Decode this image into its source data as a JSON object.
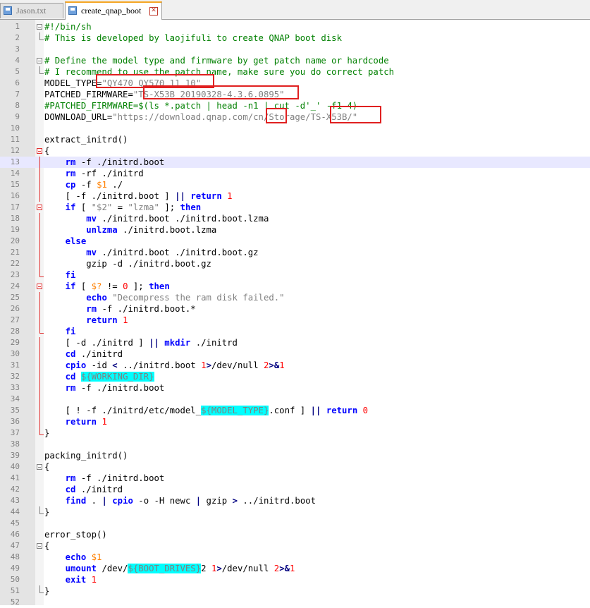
{
  "tabs": [
    {
      "label": "Jason.txt",
      "active": false,
      "icon": "save-icon"
    },
    {
      "label": "create_qnap_boot",
      "active": true,
      "icon": "save-icon",
      "close_icon": "close-icon"
    }
  ],
  "lines": [
    {
      "n": "1",
      "seg": [
        [
          "c-comment",
          "#!/bin/sh"
        ]
      ],
      "fold": "boxg"
    },
    {
      "n": "2",
      "seg": [
        [
          "c-comment",
          "# This is developed by laojifuli to create QNAP boot disk"
        ]
      ],
      "fold": "endg"
    },
    {
      "n": "3",
      "seg": [],
      "fold": ""
    },
    {
      "n": "4",
      "seg": [
        [
          "c-comment",
          "# Define the model type and firmware by get patch name or hardcode"
        ]
      ],
      "fold": "boxg"
    },
    {
      "n": "5",
      "seg": [
        [
          "c-comment",
          "# I recommend to use the patch name, make sure you do correct patch"
        ]
      ],
      "fold": "endg"
    },
    {
      "n": "6",
      "seg": [
        [
          "",
          "MODEL_TYPE="
        ],
        [
          "c-str",
          "\"QY470_QY570_11_10\""
        ]
      ],
      "fold": ""
    },
    {
      "n": "7",
      "seg": [
        [
          "",
          "PATCHED_FIRMWARE="
        ],
        [
          "c-str",
          "\"TS-X53B_20190328-4.3.6.0895\""
        ]
      ],
      "fold": ""
    },
    {
      "n": "8",
      "seg": [
        [
          "c-comment",
          "#PATCHED_FIRMWARE=$(ls *.patch | head -n1 | cut -d'_' -f1-4)"
        ]
      ],
      "fold": ""
    },
    {
      "n": "9",
      "seg": [
        [
          "",
          "DOWNLOAD_URL="
        ],
        [
          "c-str",
          "\"https://download.qnap.com/cn/Storage/TS-X53B/\""
        ]
      ],
      "fold": ""
    },
    {
      "n": "10",
      "seg": [],
      "fold": ""
    },
    {
      "n": "11",
      "seg": [
        [
          "",
          "extract_initrd()"
        ]
      ],
      "fold": ""
    },
    {
      "n": "12",
      "seg": [
        [
          "",
          "{"
        ]
      ],
      "fold": "box"
    },
    {
      "n": "13",
      "seg": [
        [
          "",
          "    "
        ],
        [
          "c-kw",
          "rm"
        ],
        [
          "",
          "",
          " -f ./initrd.boot"
        ]
      ],
      "fold": "bar",
      "current": true
    },
    {
      "n": "14",
      "seg": [
        [
          "",
          "    "
        ],
        [
          "c-kw",
          "rm"
        ],
        [
          "",
          " -rf ./initrd"
        ]
      ],
      "fold": "bar"
    },
    {
      "n": "15",
      "seg": [
        [
          "",
          "    "
        ],
        [
          "c-kw",
          "cp"
        ],
        [
          "",
          " -f "
        ],
        [
          "c-var",
          "$1"
        ],
        [
          "",
          " ./"
        ]
      ],
      "fold": "bar"
    },
    {
      "n": "16",
      "seg": [
        [
          "",
          "    [ -f ./initrd.boot ] "
        ],
        [
          "c-op",
          "||"
        ],
        [
          "",
          " "
        ],
        [
          "c-kw",
          "return"
        ],
        [
          "",
          " "
        ],
        [
          "c-num",
          "1"
        ]
      ],
      "fold": "bar"
    },
    {
      "n": "17",
      "seg": [
        [
          "",
          "    "
        ],
        [
          "c-kw",
          "if"
        ],
        [
          "",
          " [ "
        ],
        [
          "c-str",
          "\"$2\""
        ],
        [
          "",
          " = "
        ],
        [
          "c-str",
          "\"lzma\""
        ],
        [
          "",
          " ]; "
        ],
        [
          "c-kw",
          "then"
        ]
      ],
      "fold": "box"
    },
    {
      "n": "18",
      "seg": [
        [
          "",
          "        "
        ],
        [
          "c-kw",
          "mv"
        ],
        [
          "",
          " ./initrd.boot ./initrd.boot.lzma"
        ]
      ],
      "fold": "bar"
    },
    {
      "n": "19",
      "seg": [
        [
          "",
          "        "
        ],
        [
          "c-kw",
          "unlzma"
        ],
        [
          "",
          " ./initrd.boot.lzma"
        ]
      ],
      "fold": "bar"
    },
    {
      "n": "20",
      "seg": [
        [
          "",
          "    "
        ],
        [
          "c-kw",
          "else"
        ]
      ],
      "fold": "bar"
    },
    {
      "n": "21",
      "seg": [
        [
          "",
          "        "
        ],
        [
          "c-kw",
          "mv"
        ],
        [
          "",
          " ./initrd.boot ./initrd.boot.gz"
        ]
      ],
      "fold": "bar"
    },
    {
      "n": "22",
      "seg": [
        [
          "",
          "        gzip -d ./initrd.boot.gz"
        ]
      ],
      "fold": "bar"
    },
    {
      "n": "23",
      "seg": [
        [
          "",
          "    "
        ],
        [
          "c-kw",
          "fi"
        ]
      ],
      "fold": "end"
    },
    {
      "n": "24",
      "seg": [
        [
          "",
          "    "
        ],
        [
          "c-kw",
          "if"
        ],
        [
          "",
          " [ "
        ],
        [
          "c-var",
          "$?"
        ],
        [
          "",
          " != "
        ],
        [
          "c-num",
          "0"
        ],
        [
          "",
          " ]; "
        ],
        [
          "c-kw",
          "then"
        ]
      ],
      "fold": "box"
    },
    {
      "n": "25",
      "seg": [
        [
          "",
          "        "
        ],
        [
          "c-kw",
          "echo"
        ],
        [
          "",
          " "
        ],
        [
          "c-str",
          "\"Decompress the ram disk failed.\""
        ]
      ],
      "fold": "bar"
    },
    {
      "n": "26",
      "seg": [
        [
          "",
          "        "
        ],
        [
          "c-kw",
          "rm"
        ],
        [
          "",
          " -f ./initrd.boot.*"
        ]
      ],
      "fold": "bar"
    },
    {
      "n": "27",
      "seg": [
        [
          "",
          "        "
        ],
        [
          "c-kw",
          "return"
        ],
        [
          "",
          " "
        ],
        [
          "c-num",
          "1"
        ]
      ],
      "fold": "bar"
    },
    {
      "n": "28",
      "seg": [
        [
          "",
          "    "
        ],
        [
          "c-kw",
          "fi"
        ]
      ],
      "fold": "end"
    },
    {
      "n": "29",
      "seg": [
        [
          "",
          "    [ -d ./initrd ] "
        ],
        [
          "c-op",
          "||"
        ],
        [
          "",
          " "
        ],
        [
          "c-kw",
          "mkdir"
        ],
        [
          "",
          " ./initrd"
        ]
      ],
      "fold": "bar"
    },
    {
      "n": "30",
      "seg": [
        [
          "",
          "    "
        ],
        [
          "c-kw",
          "cd"
        ],
        [
          "",
          " ./initrd"
        ]
      ],
      "fold": "bar"
    },
    {
      "n": "31",
      "seg": [
        [
          "",
          "    "
        ],
        [
          "c-kw",
          "cpio"
        ],
        [
          "",
          " -id "
        ],
        [
          "c-op",
          "<"
        ],
        [
          "",
          " ../initrd.boot "
        ],
        [
          "c-num",
          "1"
        ],
        [
          "c-op",
          ">"
        ],
        [
          "",
          "/dev/null "
        ],
        [
          "c-num",
          "2"
        ],
        [
          "c-op",
          ">&"
        ],
        [
          "c-num",
          "1"
        ]
      ],
      "fold": "bar"
    },
    {
      "n": "32",
      "seg": [
        [
          "",
          "    "
        ],
        [
          "c-kw",
          "cd"
        ],
        [
          "",
          " "
        ],
        [
          "c-hl",
          "${WORKING_DIR}"
        ]
      ],
      "fold": "bar"
    },
    {
      "n": "33",
      "seg": [
        [
          "",
          "    "
        ],
        [
          "c-kw",
          "rm"
        ],
        [
          "",
          " -f ./initrd.boot"
        ]
      ],
      "fold": "bar"
    },
    {
      "n": "34",
      "seg": [],
      "fold": "bar"
    },
    {
      "n": "35",
      "seg": [
        [
          "",
          "    [ ! -f ./initrd/etc/model_"
        ],
        [
          "c-hl",
          "${MODEL_TYPE}"
        ],
        [
          "",
          ".conf ] "
        ],
        [
          "c-op",
          "||"
        ],
        [
          "",
          " "
        ],
        [
          "c-kw",
          "return"
        ],
        [
          "",
          " "
        ],
        [
          "c-num",
          "0"
        ]
      ],
      "fold": "bar"
    },
    {
      "n": "36",
      "seg": [
        [
          "",
          "    "
        ],
        [
          "c-kw",
          "return"
        ],
        [
          "",
          " "
        ],
        [
          "c-num",
          "1"
        ]
      ],
      "fold": "bar"
    },
    {
      "n": "37",
      "seg": [
        [
          "",
          "}"
        ]
      ],
      "fold": "end"
    },
    {
      "n": "38",
      "seg": [],
      "fold": ""
    },
    {
      "n": "39",
      "seg": [
        [
          "",
          "packing_initrd()"
        ]
      ],
      "fold": ""
    },
    {
      "n": "40",
      "seg": [
        [
          "",
          "{"
        ]
      ],
      "fold": "boxg"
    },
    {
      "n": "41",
      "seg": [
        [
          "",
          "    "
        ],
        [
          "c-kw",
          "rm"
        ],
        [
          "",
          " -f ./initrd.boot"
        ]
      ],
      "fold": ""
    },
    {
      "n": "42",
      "seg": [
        [
          "",
          "    "
        ],
        [
          "c-kw",
          "cd"
        ],
        [
          "",
          " ./initrd"
        ]
      ],
      "fold": ""
    },
    {
      "n": "43",
      "seg": [
        [
          "",
          "    "
        ],
        [
          "c-kw",
          "find"
        ],
        [
          "",
          " . "
        ],
        [
          "c-op",
          "|"
        ],
        [
          "",
          " "
        ],
        [
          "c-kw",
          "cpio"
        ],
        [
          "",
          " -o -H newc "
        ],
        [
          "c-op",
          "|"
        ],
        [
          "",
          " gzip "
        ],
        [
          "c-op",
          ">"
        ],
        [
          "",
          " ../initrd.boot"
        ]
      ],
      "fold": ""
    },
    {
      "n": "44",
      "seg": [
        [
          "",
          "}"
        ]
      ],
      "fold": "endg"
    },
    {
      "n": "45",
      "seg": [],
      "fold": ""
    },
    {
      "n": "46",
      "seg": [
        [
          "",
          "error_stop()"
        ]
      ],
      "fold": ""
    },
    {
      "n": "47",
      "seg": [
        [
          "",
          "{"
        ]
      ],
      "fold": "boxg"
    },
    {
      "n": "48",
      "seg": [
        [
          "",
          "    "
        ],
        [
          "c-kw",
          "echo"
        ],
        [
          "",
          " "
        ],
        [
          "c-var",
          "$1"
        ]
      ],
      "fold": ""
    },
    {
      "n": "49",
      "seg": [
        [
          "",
          "    "
        ],
        [
          "c-kw",
          "umount"
        ],
        [
          "",
          " /dev/"
        ],
        [
          "c-hl",
          "${BOOT_DRIVES}"
        ],
        [
          "",
          "2 "
        ],
        [
          "c-num",
          "1"
        ],
        [
          "c-op",
          ">"
        ],
        [
          "",
          "/dev/null "
        ],
        [
          "c-num",
          "2"
        ],
        [
          "c-op",
          ">&"
        ],
        [
          "c-num",
          "1"
        ]
      ],
      "fold": ""
    },
    {
      "n": "50",
      "seg": [
        [
          "",
          "    "
        ],
        [
          "c-kw",
          "exit"
        ],
        [
          "",
          " "
        ],
        [
          "c-num",
          "1"
        ]
      ],
      "fold": ""
    },
    {
      "n": "51",
      "seg": [
        [
          "",
          "}"
        ]
      ],
      "fold": "endg"
    },
    {
      "n": "52",
      "seg": [],
      "fold": ""
    }
  ]
}
